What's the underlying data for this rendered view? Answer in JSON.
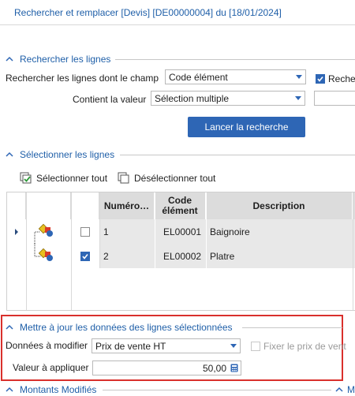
{
  "window": {
    "title": "Rechercher et remplacer [Devis] [DE00000004] du [18/01/2024]"
  },
  "search_section": {
    "title": "Rechercher les lignes",
    "field_label": "Rechercher les lignes dont le champ",
    "field_value": "Code élément",
    "extra_check_label": "Reche",
    "contains_label": "Contient la valeur",
    "contains_value": "Sélection multiple",
    "search_button": "Lancer la recherche"
  },
  "select_section": {
    "title": "Sélectionner les lignes",
    "select_all": "Sélectionner tout",
    "deselect_all": "Désélectionner tout",
    "columns": [
      "Numéro…",
      "Code élément",
      "Description"
    ],
    "rows": [
      {
        "number": "1",
        "code": "EL00001",
        "description": "Baignoire",
        "checked": false,
        "current": true
      },
      {
        "number": "2",
        "code": "EL00002",
        "description": "Platre",
        "checked": true,
        "current": false
      }
    ]
  },
  "update_section": {
    "title": "Mettre à jour les données des lignes sélectionnées",
    "data_label": "Données à modifier",
    "data_value": "Prix de vente HT",
    "fix_price_label": "Fixer le prix de vent",
    "value_label": "Valeur à appliquer",
    "value": "50,00"
  },
  "amounts_section": {
    "title": "Montants Modifiés",
    "right_letter": "M"
  },
  "colors": {
    "accent": "#2e66b5",
    "section_title": "#1f5fa8",
    "highlight_border": "#d9302c",
    "grid_header": "#dcdcdc",
    "grid_row": "#e8e8e8"
  }
}
